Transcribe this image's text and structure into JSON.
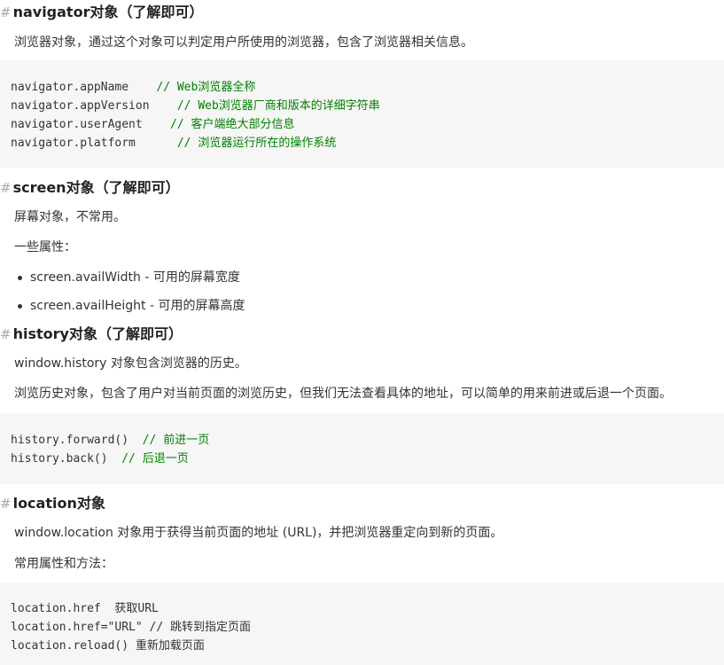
{
  "heading_mark": "#",
  "navigator": {
    "title": "navigator对象（了解即可）",
    "desc": "浏览器对象，通过这个对象可以判定用户所使用的浏览器，包含了浏览器相关信息。",
    "code": [
      {
        "code": "navigator.appName    ",
        "comment": "// Web浏览器全称"
      },
      {
        "code": "navigator.appVersion    ",
        "comment": "// Web浏览器厂商和版本的详细字符串"
      },
      {
        "code": "navigator.userAgent    ",
        "comment": "// 客户端绝大部分信息"
      },
      {
        "code": "navigator.platform      ",
        "comment": "// 浏览器运行所在的操作系统"
      }
    ]
  },
  "screen": {
    "title": "screen对象（了解即可）",
    "desc": "屏幕对象，不常用。",
    "props_label": "一些属性：",
    "items": [
      "screen.availWidth - 可用的屏幕宽度",
      "screen.availHeight - 可用的屏幕高度"
    ]
  },
  "history": {
    "title": "history对象（了解即可）",
    "desc1": "window.history 对象包含浏览器的历史。",
    "desc2": "浏览历史对象，包含了用户对当前页面的浏览历史，但我们无法查看具体的地址，可以简单的用来前进或后退一个页面。",
    "code": [
      {
        "code": "history.forward()  ",
        "comment": "// 前进一页"
      },
      {
        "code": "history.back()  ",
        "comment": "// 后退一页"
      }
    ]
  },
  "location": {
    "title": "location对象",
    "desc": "window.location 对象用于获得当前页面的地址 (URL)，并把浏览器重定向到新的页面。",
    "methods_label": "常用属性和方法：",
    "code": [
      {
        "code": "location.href  获取URL"
      },
      {
        "code": "location.href=\"URL\" // 跳转到指定页面"
      },
      {
        "code": "location.reload() 重新加载页面"
      }
    ]
  }
}
